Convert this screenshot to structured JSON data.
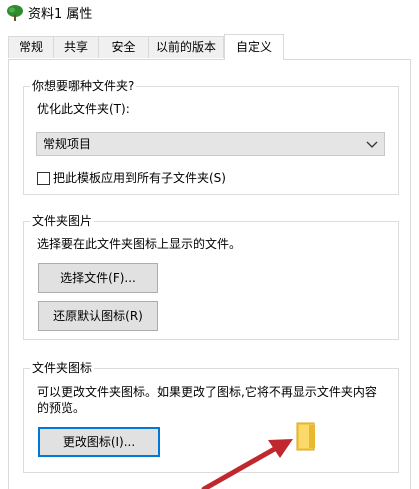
{
  "window": {
    "title": "资料1 属性",
    "icon": "tree-icon"
  },
  "tabs": [
    {
      "label": "常规"
    },
    {
      "label": "共享"
    },
    {
      "label": "安全"
    },
    {
      "label": "以前的版本"
    },
    {
      "label": "自定义",
      "active": true
    }
  ],
  "optimize": {
    "group_title": "你想要哪种文件夹?",
    "optimize_label": "优化此文件夹(T):",
    "selected_value": "常规项目",
    "apply_checkbox_label": "把此模板应用到所有子文件夹(S)",
    "apply_checked": false
  },
  "folder_pictures": {
    "group_title": "文件夹图片",
    "description": "选择要在此文件夹图标上显示的文件。",
    "choose_file_button": "选择文件(F)...",
    "restore_default_button": "还原默认图标(R)"
  },
  "folder_icons": {
    "group_title": "文件夹图标",
    "description_line1": "可以更改文件夹图标。如果更改了图标,它将不再显示文件夹内容",
    "description_line2": "的预览。",
    "change_icon_button": "更改图标(I)..."
  },
  "colors": {
    "accent": "#0078d7",
    "arrow": "#c0282d",
    "folder": "#f5c842"
  }
}
